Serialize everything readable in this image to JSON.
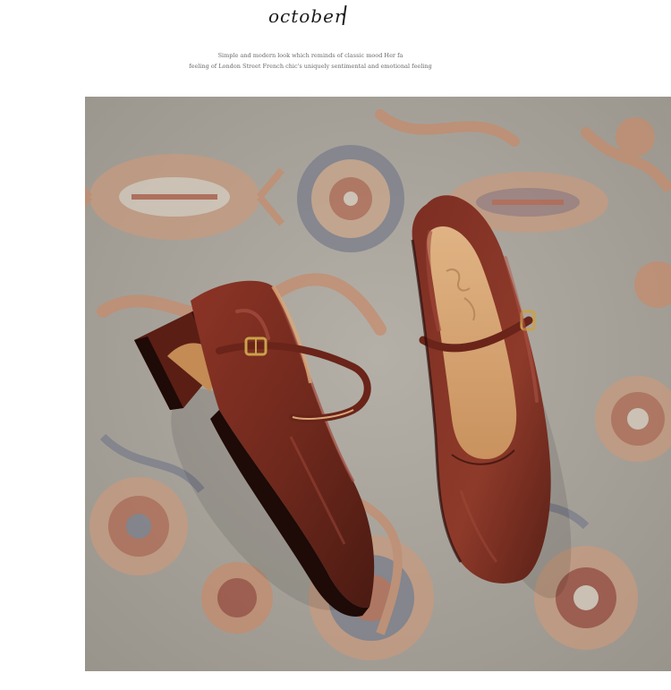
{
  "header": {
    "brand": "october",
    "tagline_line1": "Simple and modern look which reminds of classic mood  Her fa",
    "tagline_line2": "feeling of London Street French chic's uniquely sentimental and emotional feeling"
  },
  "photo": {
    "colors": {
      "rug_base": "#a8a49c",
      "rug_pattern": "#c48c6c",
      "leather": "#7a2c20",
      "insole": "#d9a878"
    }
  }
}
